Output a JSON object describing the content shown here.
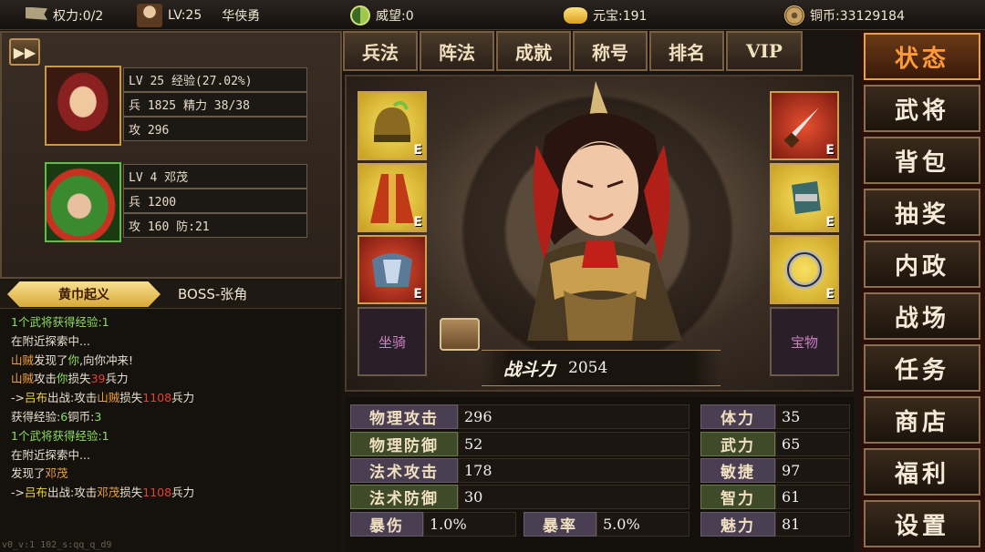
{
  "topbar": {
    "power": "权力:0/2",
    "level": "LV:25",
    "name": "华侠勇",
    "prestige": "威望:0",
    "yuanbao": "元宝:191",
    "copper": "铜币:33129184"
  },
  "party": {
    "ff_label": "▶▶",
    "heroes": [
      {
        "line1": "LV 25 经验(27.02%)",
        "line2": "兵 1825 精力 38/38",
        "line3": "攻 296"
      },
      {
        "line1": "LV 4  邓茂",
        "line2": "兵 1200",
        "line3": "攻 160 防:21"
      }
    ]
  },
  "chapter": {
    "tab": "黄巾起义",
    "boss": "BOSS-张角"
  },
  "log": [
    [
      {
        "t": "1个武将获得经验:1",
        "c": "green"
      }
    ],
    [
      {
        "t": "在附近探索中...",
        "c": ""
      }
    ],
    [
      {
        "t": "山贼",
        "c": "orange"
      },
      {
        "t": "发现了",
        "c": ""
      },
      {
        "t": "你",
        "c": "green"
      },
      {
        "t": ",向你冲来!",
        "c": ""
      }
    ],
    [
      {
        "t": "山贼",
        "c": "orange"
      },
      {
        "t": "攻击",
        "c": ""
      },
      {
        "t": "你",
        "c": "green"
      },
      {
        "t": "损失",
        "c": ""
      },
      {
        "t": "39",
        "c": "red"
      },
      {
        "t": "兵力",
        "c": ""
      }
    ],
    [
      {
        "t": "->",
        "c": ""
      },
      {
        "t": "吕布",
        "c": "yellow"
      },
      {
        "t": "出战:攻击",
        "c": ""
      },
      {
        "t": "山贼",
        "c": "orange"
      },
      {
        "t": "损失",
        "c": ""
      },
      {
        "t": "1108",
        "c": "red"
      },
      {
        "t": "兵力",
        "c": ""
      }
    ],
    [
      {
        "t": "获得经验:",
        "c": ""
      },
      {
        "t": "6",
        "c": "green"
      },
      {
        "t": "铜币:",
        "c": ""
      },
      {
        "t": "3",
        "c": "green"
      }
    ],
    [
      {
        "t": "1个武将获得经验:1",
        "c": "green"
      }
    ],
    [
      {
        "t": "在附近探索中...",
        "c": ""
      }
    ],
    [
      {
        "t": "发现了",
        "c": ""
      },
      {
        "t": "邓茂",
        "c": "orange"
      }
    ],
    [
      {
        "t": "->",
        "c": ""
      },
      {
        "t": "吕布",
        "c": "yellow"
      },
      {
        "t": "出战:攻击",
        "c": ""
      },
      {
        "t": "邓茂",
        "c": "orange"
      },
      {
        "t": "损失",
        "c": ""
      },
      {
        "t": "1108",
        "c": "red"
      },
      {
        "t": "兵力",
        "c": ""
      }
    ]
  ],
  "version": "v0_v:1 102_s:qq_q_d9",
  "center_tabs": [
    "兵法",
    "阵法",
    "成就",
    "称号",
    "排名",
    "VIP"
  ],
  "equipment": {
    "slot_badge": "E",
    "left_icons": [
      "helmet-icon",
      "robe-icon",
      "armor-icon"
    ],
    "right_icons": [
      "dagger-icon",
      "bracer-icon",
      "ring-icon"
    ],
    "mount_label": "坐骑",
    "treasure_label": "宝物"
  },
  "power": {
    "label": "战斗力",
    "value": "2054"
  },
  "stats": {
    "left": [
      {
        "label": "物理攻击",
        "value": "296",
        "tone": "purple"
      },
      {
        "label": "物理防御",
        "value": "52",
        "tone": "green"
      },
      {
        "label": "法术攻击",
        "value": "178",
        "tone": "purple"
      },
      {
        "label": "法术防御",
        "value": "30",
        "tone": "green"
      }
    ],
    "crit_damage": {
      "label": "暴伤",
      "value": "1.0%"
    },
    "crit_rate": {
      "label": "暴率",
      "value": "5.0%"
    },
    "right": [
      {
        "label": "体力",
        "value": "35",
        "tone": "purple"
      },
      {
        "label": "武力",
        "value": "65",
        "tone": "green"
      },
      {
        "label": "敏捷",
        "value": "97",
        "tone": "purple"
      },
      {
        "label": "智力",
        "value": "61",
        "tone": "green"
      },
      {
        "label": "魅力",
        "value": "81",
        "tone": "purple"
      }
    ]
  },
  "menu": [
    "状态",
    "武将",
    "背包",
    "抽奖",
    "内政",
    "战场",
    "任务",
    "商店",
    "福利",
    "设置"
  ],
  "colors": {
    "active_menu": "#ff9a3a",
    "accent_gold": "#c8a050"
  }
}
